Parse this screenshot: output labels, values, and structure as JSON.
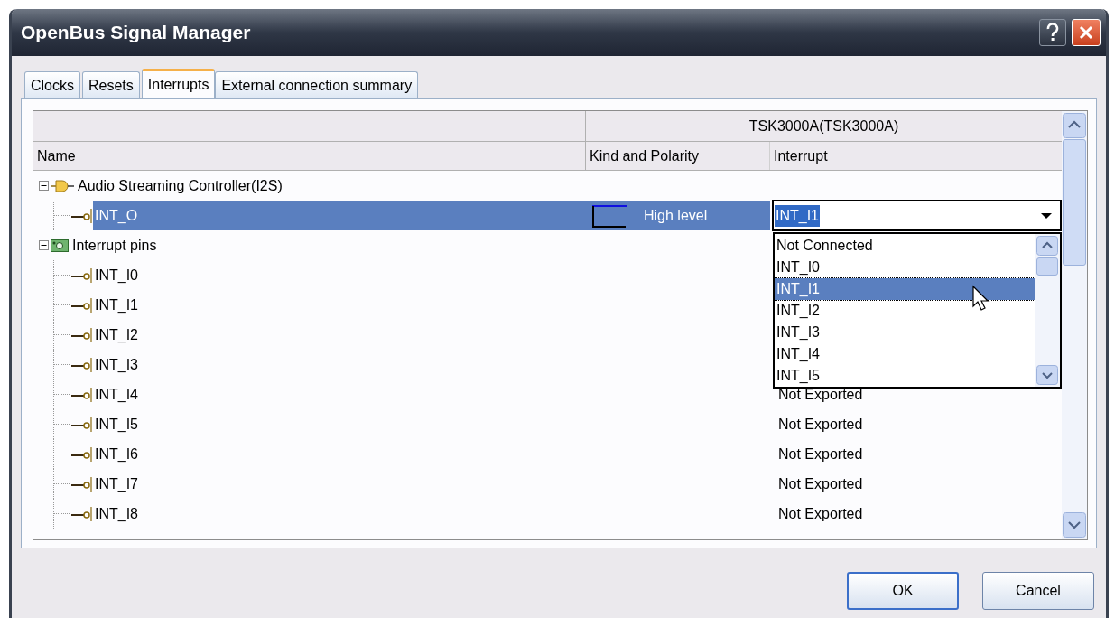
{
  "window": {
    "title": "OpenBus Signal Manager"
  },
  "tabs": [
    {
      "label": "Clocks",
      "selected": false
    },
    {
      "label": "Resets",
      "selected": false
    },
    {
      "label": "Interrupts",
      "selected": true
    },
    {
      "label": "External connection summary",
      "selected": false
    }
  ],
  "table": {
    "group_header": "TSK3000A(TSK3000A)",
    "columns": [
      "Name",
      "Kind and Polarity",
      "Interrupt"
    ],
    "tree": [
      {
        "name": "Audio Streaming Controller(I2S)",
        "kind": "component",
        "expanded": true,
        "children": [
          {
            "name": "INT_O",
            "selected": true,
            "polarity": "High level",
            "interrupt": {
              "kind": "combo",
              "value": "INT_I1"
            }
          }
        ]
      },
      {
        "name": "Interrupt pins",
        "kind": "pins",
        "expanded": true,
        "children": [
          {
            "name": "INT_I0",
            "selected": false
          },
          {
            "name": "INT_I1",
            "selected": false
          },
          {
            "name": "INT_I2",
            "selected": false
          },
          {
            "name": "INT_I3",
            "selected": false
          },
          {
            "name": "INT_I4",
            "selected": false,
            "interrupt": {
              "kind": "text",
              "value": "Not Exported"
            }
          },
          {
            "name": "INT_I5",
            "selected": false,
            "interrupt": {
              "kind": "text",
              "value": "Not Exported"
            }
          },
          {
            "name": "INT_I6",
            "selected": false,
            "interrupt": {
              "kind": "text",
              "value": "Not Exported"
            }
          },
          {
            "name": "INT_I7",
            "selected": false,
            "interrupt": {
              "kind": "text",
              "value": "Not Exported"
            }
          },
          {
            "name": "INT_I8",
            "selected": false,
            "interrupt": {
              "kind": "text",
              "value": "Not Exported"
            }
          }
        ]
      }
    ]
  },
  "dropdown": {
    "items": [
      {
        "label": "Not Connected",
        "selected": false
      },
      {
        "label": "INT_I0",
        "selected": false
      },
      {
        "label": "INT_I1",
        "selected": true
      },
      {
        "label": "INT_I2",
        "selected": false
      },
      {
        "label": "INT_I3",
        "selected": false
      },
      {
        "label": "INT_I4",
        "selected": false
      },
      {
        "label": "INT_I5",
        "selected": false
      }
    ]
  },
  "buttons": [
    "OK",
    "Cancel"
  ]
}
